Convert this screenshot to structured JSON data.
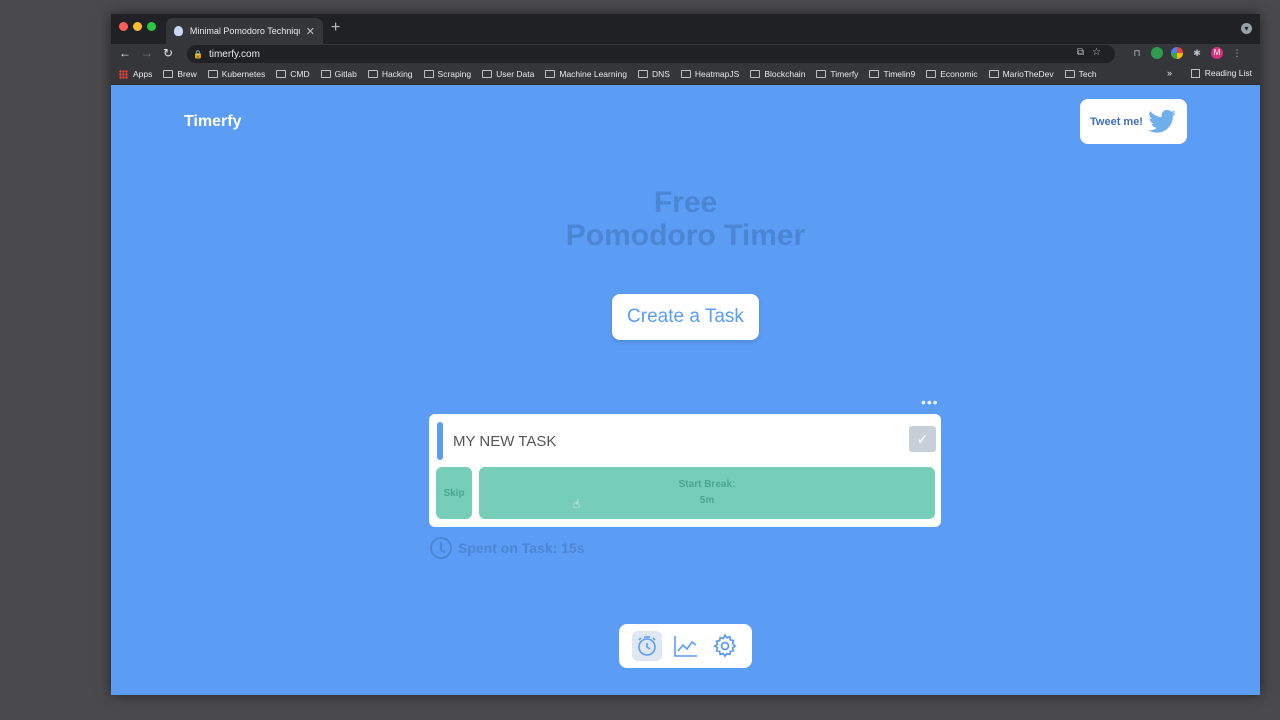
{
  "browser": {
    "tab_title": "Minimal Pomodoro Technique",
    "url": "timerfy.com",
    "bookmarks": [
      "Apps",
      "Brew",
      "Kubernetes",
      "CMD",
      "Gitlab",
      "Hacking",
      "Scraping",
      "User Data",
      "Machine Learning",
      "DNS",
      "HeatmapJS",
      "Blockchain",
      "Timerfy",
      "Timelin9",
      "Economic",
      "MarioTheDev",
      "Tech"
    ],
    "bookmarks_overflow": "»",
    "reading_list": "Reading List",
    "avatar_letter": "M"
  },
  "page": {
    "logo": "Timerfy",
    "tweet_label": "Tweet me!",
    "hero_line1": "Free",
    "hero_line2": "Pomodoro Timer",
    "create_task_label": "Create a Task",
    "more_dots": "•••",
    "task": {
      "title": "MY NEW TASK",
      "skip_label": "Skip",
      "break_line1": "Start Break:",
      "break_line2": "5m"
    },
    "spent_text": "Spent on Task: 15s"
  },
  "colors": {
    "background": "#5b9cf4",
    "accent_green": "#76cdb8",
    "text_blue": "#4b86d4"
  },
  "nav_icons": [
    "timer-icon",
    "chart-icon",
    "settings-icon"
  ]
}
